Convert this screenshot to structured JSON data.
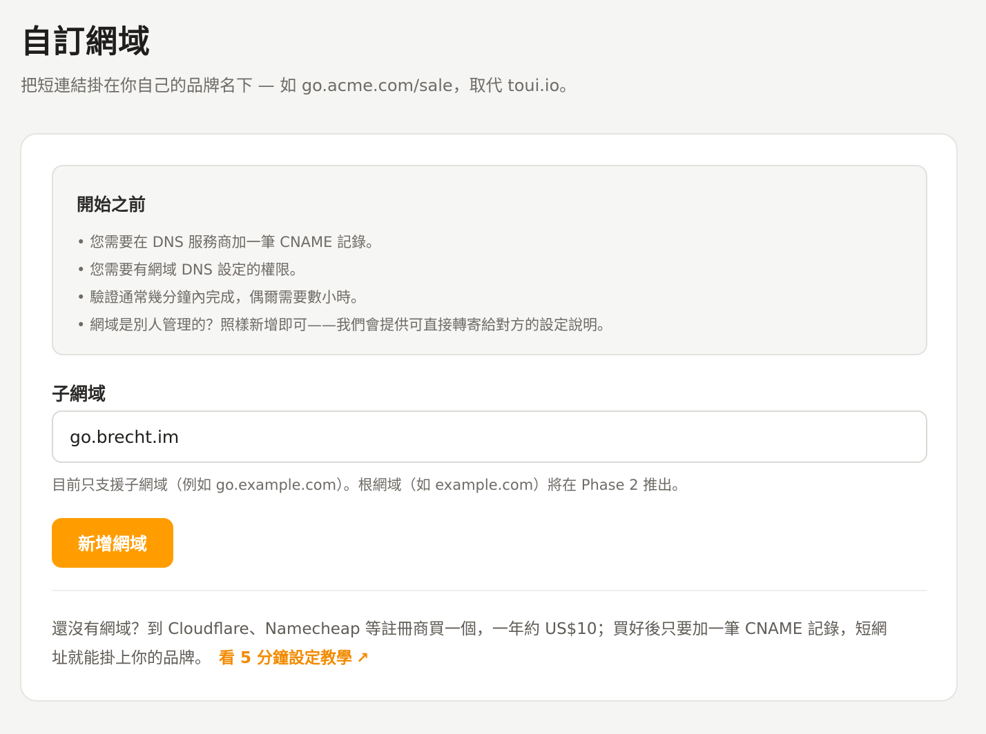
{
  "header": {
    "title": "自訂網域",
    "subtitle": "把短連結掛在你自己的品牌名下 — 如 go.acme.com/sale，取代 toui.io。"
  },
  "info_box": {
    "title": "開始之前",
    "items": [
      "您需要在 DNS 服務商加一筆 CNAME 記錄。",
      "您需要有網域 DNS 設定的權限。",
      "驗證通常幾分鐘內完成，偶爾需要數小時。",
      "網域是別人管理的？照樣新增即可——我們會提供可直接轉寄給對方的設定說明。"
    ]
  },
  "form": {
    "label": "子網域",
    "input_value": "go.brecht.im",
    "hint": "目前只支援子網域（例如 go.example.com）。根網域（如 example.com）將在 Phase 2 推出。",
    "button_label": "新增網域"
  },
  "footer": {
    "text": "還沒有網域？到 Cloudflare、Namecheap 等註冊商買一個，一年約 US$10；買好後只要加一筆 CNAME 記錄，短網址就能掛上你的品牌。",
    "link_label": "看 5 分鐘設定教學",
    "link_icon": "arrow-up-right-icon"
  },
  "colors": {
    "accent": "#ff9d00",
    "link": "#f28a00"
  }
}
